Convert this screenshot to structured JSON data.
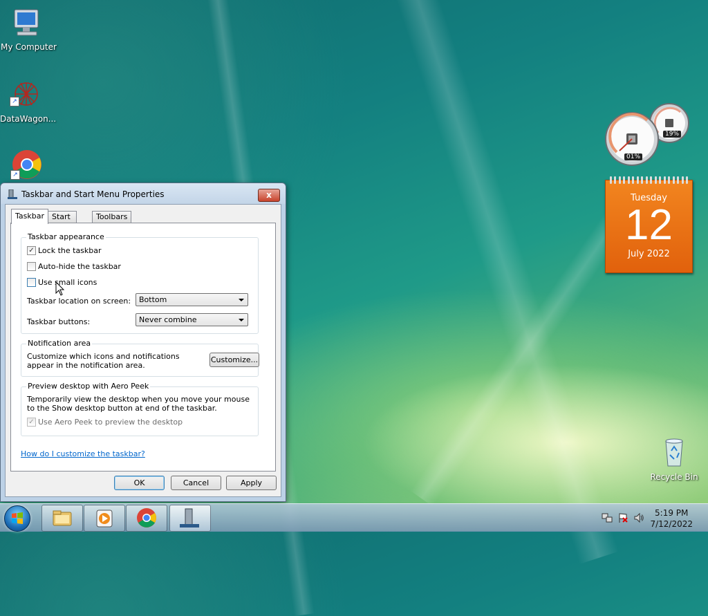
{
  "desktop": {
    "icons": [
      {
        "label": "My Computer",
        "icon": "computer-icon"
      },
      {
        "label": "DataWagon...",
        "icon": "datawagon-icon"
      },
      {
        "label": "",
        "icon": "chrome-icon"
      },
      {
        "label": "Recycle Bin",
        "icon": "recycle-bin-icon"
      }
    ]
  },
  "gadgets": {
    "cpu_meter": {
      "cpu": "01%",
      "memory": "19%"
    },
    "calendar": {
      "weekday": "Tuesday",
      "day": "12",
      "month_year": "July 2022"
    }
  },
  "dialog": {
    "title": "Taskbar and Start Menu Properties",
    "close_label": "x",
    "tabs": [
      {
        "label": "Taskbar",
        "active": true
      },
      {
        "label": "Start Menu",
        "active": false
      },
      {
        "label": "Toolbars",
        "active": false
      }
    ],
    "appearance": {
      "title": "Taskbar appearance",
      "lock": {
        "label": "Lock the taskbar",
        "checked": true
      },
      "autohide": {
        "label": "Auto-hide the taskbar",
        "checked": false
      },
      "small_icons": {
        "label": "Use small icons",
        "checked": false
      },
      "location_label": "Taskbar location on screen:",
      "location_value": "Bottom",
      "buttons_label": "Taskbar buttons:",
      "buttons_value": "Never combine"
    },
    "notification": {
      "title": "Notification area",
      "text": "Customize which icons and notifications appear in the notification area.",
      "customize_label": "Customize..."
    },
    "peek": {
      "title": "Preview desktop with Aero Peek",
      "text": "Temporarily view the desktop when you move your mouse to the Show desktop button at end of the taskbar.",
      "checkbox_label": "Use Aero Peek to preview the desktop",
      "checked": true,
      "enabled": false
    },
    "help_link": "How do I customize the taskbar?",
    "ok_label": "OK",
    "cancel_label": "Cancel",
    "apply_label": "Apply"
  },
  "taskbar": {
    "buttons": [
      "explorer-icon",
      "media-player-icon",
      "chrome-icon",
      "taskbar-properties-icon"
    ],
    "clock_time": "5:19 PM",
    "clock_date": "7/12/2022"
  }
}
